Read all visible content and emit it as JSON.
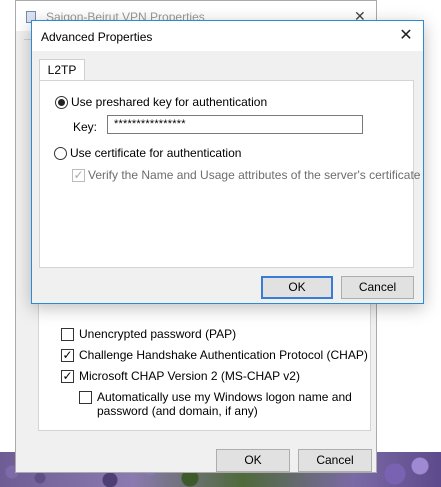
{
  "background_window": {
    "title": "Saigon-Beirut VPN Properties",
    "close_glyph": "✕",
    "options": [
      {
        "label": "Unencrypted password (PAP)",
        "checked": false
      },
      {
        "label": "Challenge Handshake Authentication Protocol (CHAP)",
        "checked": true
      },
      {
        "label": "Microsoft CHAP Version 2 (MS-CHAP v2)",
        "checked": true
      }
    ],
    "sub_option": {
      "line1": "Automatically use my Windows logon name and",
      "line2": "password (and domain, if any)",
      "checked": false
    },
    "ok_label": "OK",
    "cancel_label": "Cancel"
  },
  "dialog": {
    "title": "Advanced Properties",
    "close_glyph": "✕",
    "tab_label": "L2TP",
    "preshared_label": "Use preshared key for authentication",
    "key_label": "Key:",
    "key_value": "****************",
    "certificate_label": "Use certificate for authentication",
    "verify_label": "Verify the Name and Usage attributes of the server's certificate",
    "verify_checked": true,
    "ok_label": "OK",
    "cancel_label": "Cancel",
    "selected_auth": "preshared"
  },
  "colors": {
    "accent": "#2a8bd6",
    "dialog_bg": "#f0f0f0"
  }
}
